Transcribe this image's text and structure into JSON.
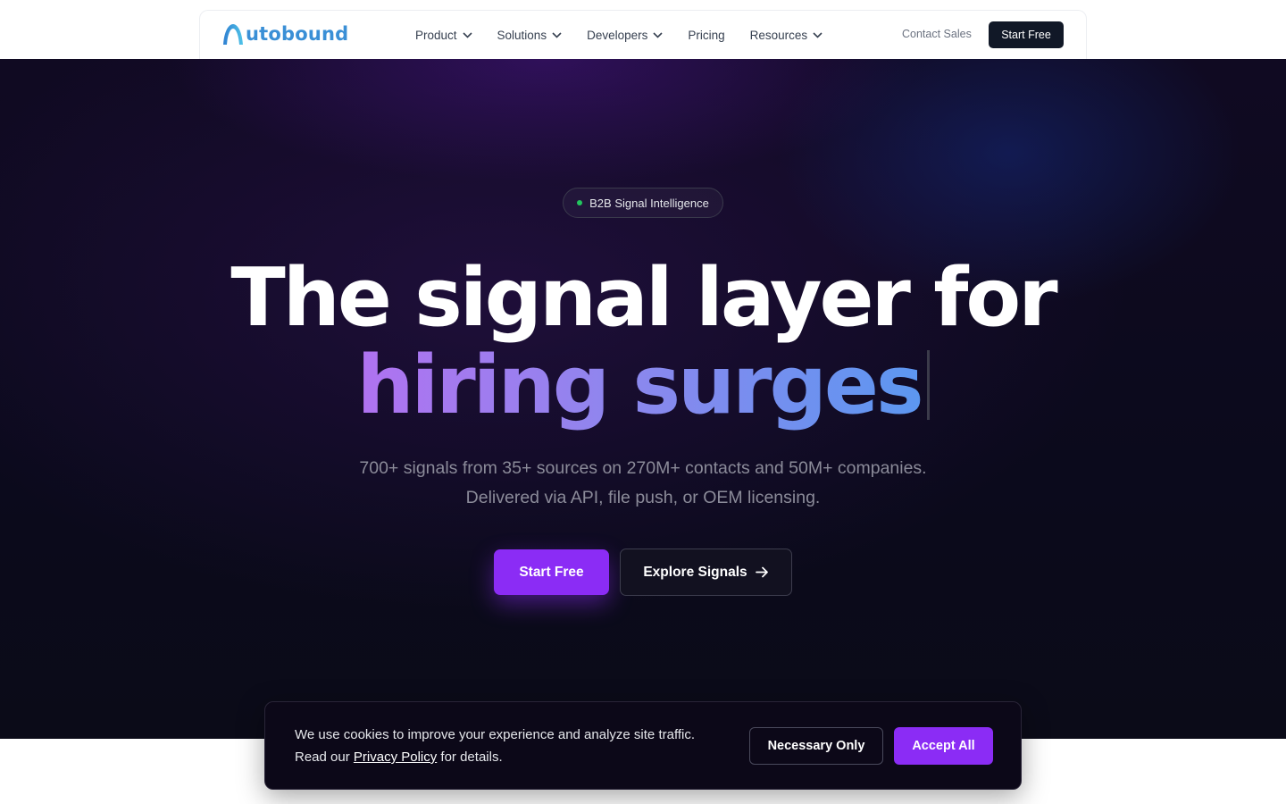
{
  "nav": {
    "logo_text": "utobound",
    "menu": [
      {
        "label": "Product",
        "has_dropdown": true
      },
      {
        "label": "Solutions",
        "has_dropdown": true
      },
      {
        "label": "Developers",
        "has_dropdown": true
      },
      {
        "label": "Pricing",
        "has_dropdown": false
      },
      {
        "label": "Resources",
        "has_dropdown": true
      }
    ],
    "contact_label": "Contact Sales",
    "cta_label": "Start Free"
  },
  "hero": {
    "badge": "B2B Signal Intelligence",
    "headline_line1": "The signal layer for",
    "headline_line2": "hiring surges",
    "subtitle_line1": "700+ signals from 35+ sources on 270M+ contacts and 50M+ companies.",
    "subtitle_line2": "Delivered via API, file push, or OEM licensing.",
    "primary_cta": "Start Free",
    "secondary_cta": "Explore Signals"
  },
  "cookie": {
    "line1": "We use cookies to improve your experience and analyze site traffic.",
    "line2_prefix": "Read our",
    "link": "Privacy Policy",
    "line2_suffix": "for details.",
    "necessary_label": "Necessary Only",
    "accept_label": "Accept All"
  },
  "colors": {
    "brand_blue": "#3a8fd6",
    "accent_purple": "#8b2cf5",
    "nav_dark": "#111827",
    "hero_bg": "#0b0a1c"
  }
}
